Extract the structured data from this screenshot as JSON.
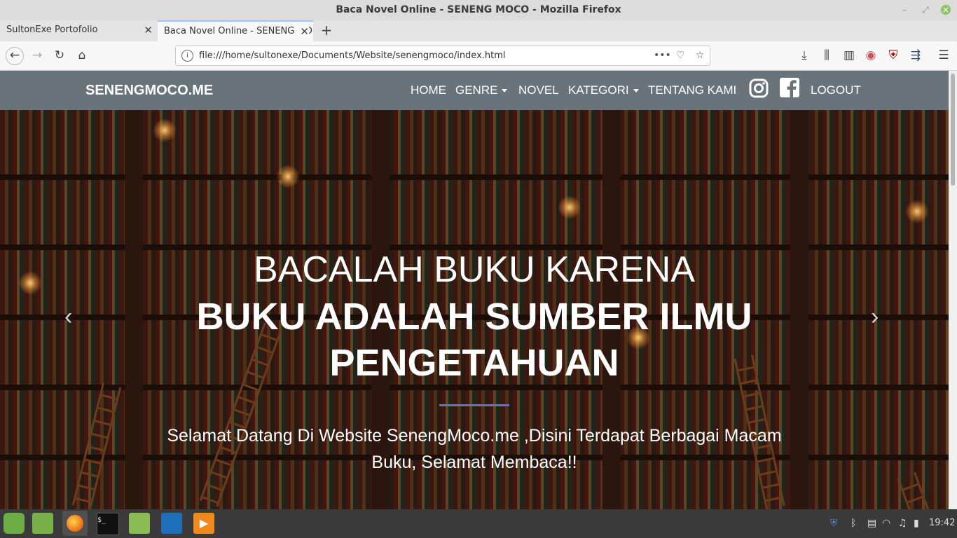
{
  "window": {
    "title": "Baca Novel Online - SENENG MOCO - Mozilla Firefox"
  },
  "tabs": [
    {
      "label": "SultonExe Portofolio",
      "active": false
    },
    {
      "label": "Baca Novel Online - SENENG MO",
      "active": true
    }
  ],
  "address_bar": {
    "url": "file:///home/sultonexe/Documents/Website/senengmoco/index.html"
  },
  "site": {
    "brand": "SENENGMOCO.ME",
    "menu": {
      "home": "HOME",
      "genre": "GENRE",
      "novel": "NOVEL",
      "kategori": "KATEGORI",
      "tentang": "TENTANG KAMI",
      "logout": "LOGOUT"
    },
    "hero": {
      "line1": "BACALAH BUKU KARENA",
      "line2": "BUKU ADALAH SUMBER ILMU",
      "line3": "PENGETAHUAN",
      "welcome_line1": "Selamat Datang Di Website SenengMoco.me ,Disini Terdapat Berbagai Macam",
      "welcome_line2": "Buku, Selamat Membaca!!"
    },
    "nav_color": "#6b737a",
    "accent": "#6a6ad0"
  },
  "taskbar": {
    "clock": "19:42"
  }
}
